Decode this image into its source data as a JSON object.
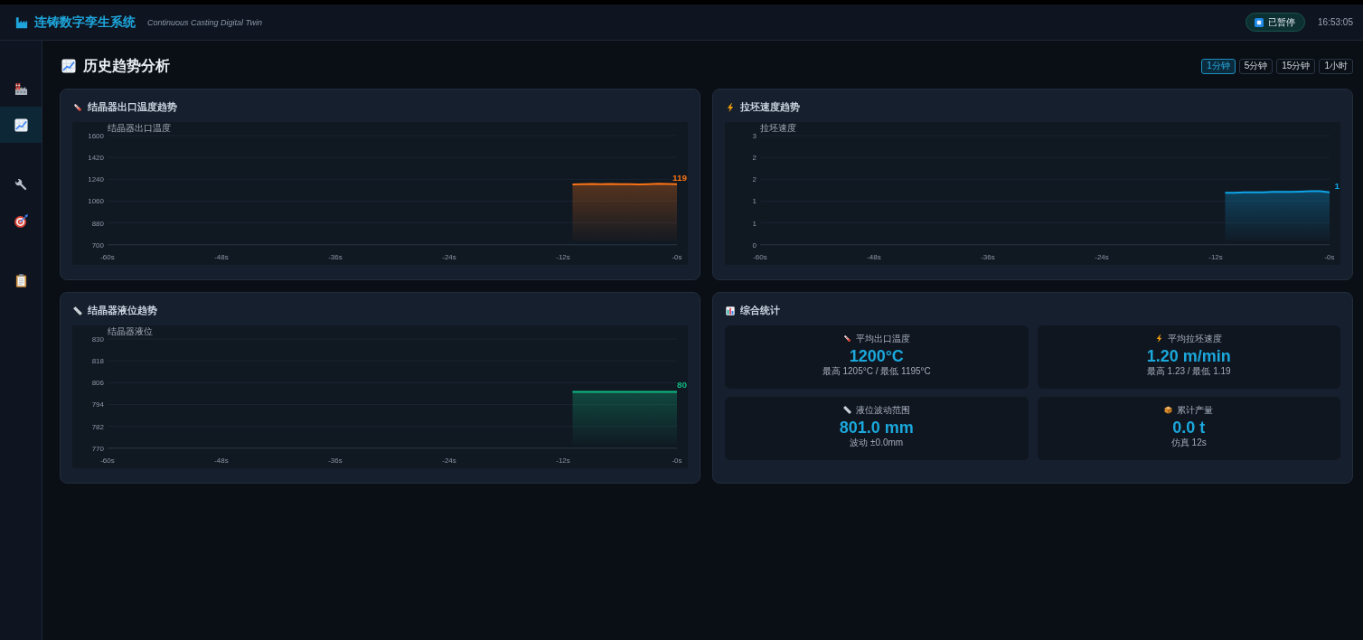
{
  "header": {
    "title": "连铸数字孪生系统",
    "subtitle": "Continuous Casting Digital Twin",
    "status": {
      "label": "已暂停"
    },
    "time": "16:53:05"
  },
  "sidebar": {
    "groups": [
      {
        "items": [
          {
            "selected": false
          },
          {
            "selected": true
          }
        ]
      },
      {
        "items": [
          {
            "selected": false
          },
          {
            "selected": false
          }
        ]
      },
      {
        "items": [
          {
            "selected": false
          }
        ]
      }
    ]
  },
  "page": {
    "title": "历史趋势分析",
    "ranges": [
      {
        "label": "1分钟",
        "selected": true
      },
      {
        "label": "5分钟",
        "selected": false
      },
      {
        "label": "15分钟",
        "selected": false
      },
      {
        "label": "1小时",
        "selected": false
      }
    ]
  },
  "panels": [
    {
      "kind": "chart",
      "title": "结晶器出口温度趋势",
      "chart_data": {
        "type": "area",
        "ylabel": "结晶器出口温度",
        "x": [
          -11,
          -10,
          -9,
          -8,
          -7,
          -6,
          -5,
          -4,
          -3,
          -2,
          -1,
          0
        ],
        "series": [
          {
            "color": "#f97316",
            "values": [
              1198,
              1199,
              1201,
              1200,
              1202,
              1200,
              1199,
              1198,
              1200,
              1203,
              1201,
              1199
            ]
          }
        ],
        "xlim": [
          -60,
          0
        ],
        "ylim": [
          700,
          1600
        ],
        "xticks": [
          {
            "value": -60,
            "label": "-60s"
          },
          {
            "value": -48,
            "label": "-48s"
          },
          {
            "value": -36,
            "label": "-36s"
          },
          {
            "value": -24,
            "label": "-24s"
          },
          {
            "value": -12,
            "label": "-12s"
          },
          {
            "value": 0,
            "label": "-0s"
          }
        ],
        "yticks": [
          700,
          880,
          1060,
          1240,
          1420,
          1600
        ],
        "grid": true,
        "annotations": [
          "119"
        ]
      }
    },
    {
      "kind": "chart",
      "title": "拉坯速度趋势",
      "chart_data": {
        "type": "area",
        "ylabel": "拉坯速度",
        "x": [
          -11,
          -10,
          -9,
          -8,
          -7,
          -6,
          -5,
          -4,
          -3,
          -2,
          -1,
          0
        ],
        "series": [
          {
            "color": "#0ea5e9",
            "values": [
              1.19,
              1.19,
              1.2,
              1.2,
              1.2,
              1.21,
              1.21,
              1.21,
              1.22,
              1.23,
              1.23,
              1.2
            ]
          }
        ],
        "xlim": [
          -60,
          0
        ],
        "ylim": [
          0,
          2.5
        ],
        "xticks": [
          {
            "value": -60,
            "label": "-60s"
          },
          {
            "value": -48,
            "label": "-48s"
          },
          {
            "value": -36,
            "label": "-36s"
          },
          {
            "value": -24,
            "label": "-24s"
          },
          {
            "value": -12,
            "label": "-12s"
          },
          {
            "value": 0,
            "label": "-0s"
          }
        ],
        "yticks": [
          {
            "value": 0,
            "label": "0"
          },
          {
            "value": 0.5,
            "label": "1"
          },
          {
            "value": 1,
            "label": "1"
          },
          {
            "value": 1.5,
            "label": "2"
          },
          {
            "value": 2,
            "label": "2"
          },
          {
            "value": 2.5,
            "label": "3"
          }
        ],
        "grid": true,
        "annotations": [
          "1"
        ]
      }
    },
    {
      "kind": "chart",
      "title": "结晶器液位趋势",
      "chart_data": {
        "type": "area",
        "ylabel": "结晶器液位",
        "x": [
          -11,
          -10,
          -9,
          -8,
          -7,
          -6,
          -5,
          -4,
          -3,
          -2,
          -1,
          0
        ],
        "series": [
          {
            "color": "#10b981",
            "values": [
              801,
              801,
              801,
              801,
              801,
              801,
              801,
              801,
              801,
              801,
              801,
              801
            ]
          }
        ],
        "xlim": [
          -60,
          0
        ],
        "ylim": [
          770,
          830
        ],
        "xticks": [
          {
            "value": -60,
            "label": "-60s"
          },
          {
            "value": -48,
            "label": "-48s"
          },
          {
            "value": -36,
            "label": "-36s"
          },
          {
            "value": -24,
            "label": "-24s"
          },
          {
            "value": -12,
            "label": "-12s"
          },
          {
            "value": 0,
            "label": "-0s"
          }
        ],
        "yticks": [
          770,
          782,
          794,
          806,
          818,
          830
        ],
        "grid": true,
        "annotations": [
          "80"
        ]
      }
    },
    {
      "kind": "stats",
      "title": "综合统计",
      "stats": [
        {
          "label": "平均出口温度",
          "value": "1200°C",
          "detail": "最高 1205°C / 最低 1195°C"
        },
        {
          "label": "平均拉坯速度",
          "value": "1.20 m/min",
          "detail": "最高 1.23 / 最低 1.19"
        },
        {
          "label": "液位波动范围",
          "value": "801.0 mm",
          "detail": "波动 ±0.0mm"
        },
        {
          "label": "累计产量",
          "value": "0.0 t",
          "detail": "仿真 12s"
        }
      ]
    }
  ]
}
